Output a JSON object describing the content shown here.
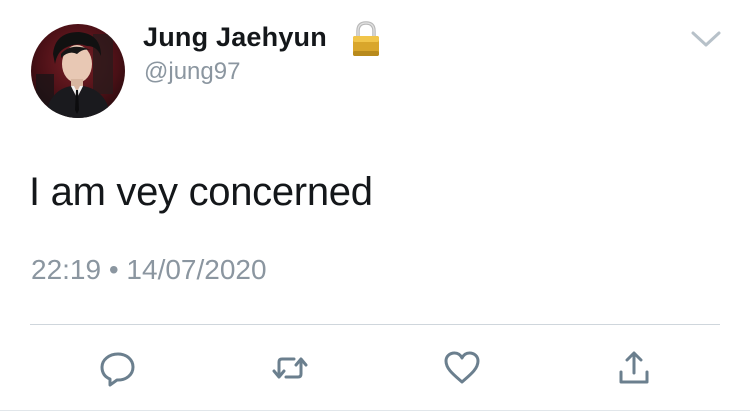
{
  "user": {
    "display_name": "Jung Jaehyun",
    "handle": "@jung97",
    "protected_icon": "lock-icon",
    "avatar": "profile-photo"
  },
  "tweet": {
    "text": "I am vey concerned",
    "timestamp": "22:19 • 14/07/2020"
  },
  "menu": {
    "icon": "chevron-down-icon"
  },
  "actions": [
    {
      "icon": "reply-icon"
    },
    {
      "icon": "retweet-icon"
    },
    {
      "icon": "like-icon"
    },
    {
      "icon": "share-icon"
    }
  ],
  "colors": {
    "text": "#14171a",
    "secondary": "#8b96a0",
    "icon": "#6b7f8e",
    "divider": "#cfd6dc"
  }
}
